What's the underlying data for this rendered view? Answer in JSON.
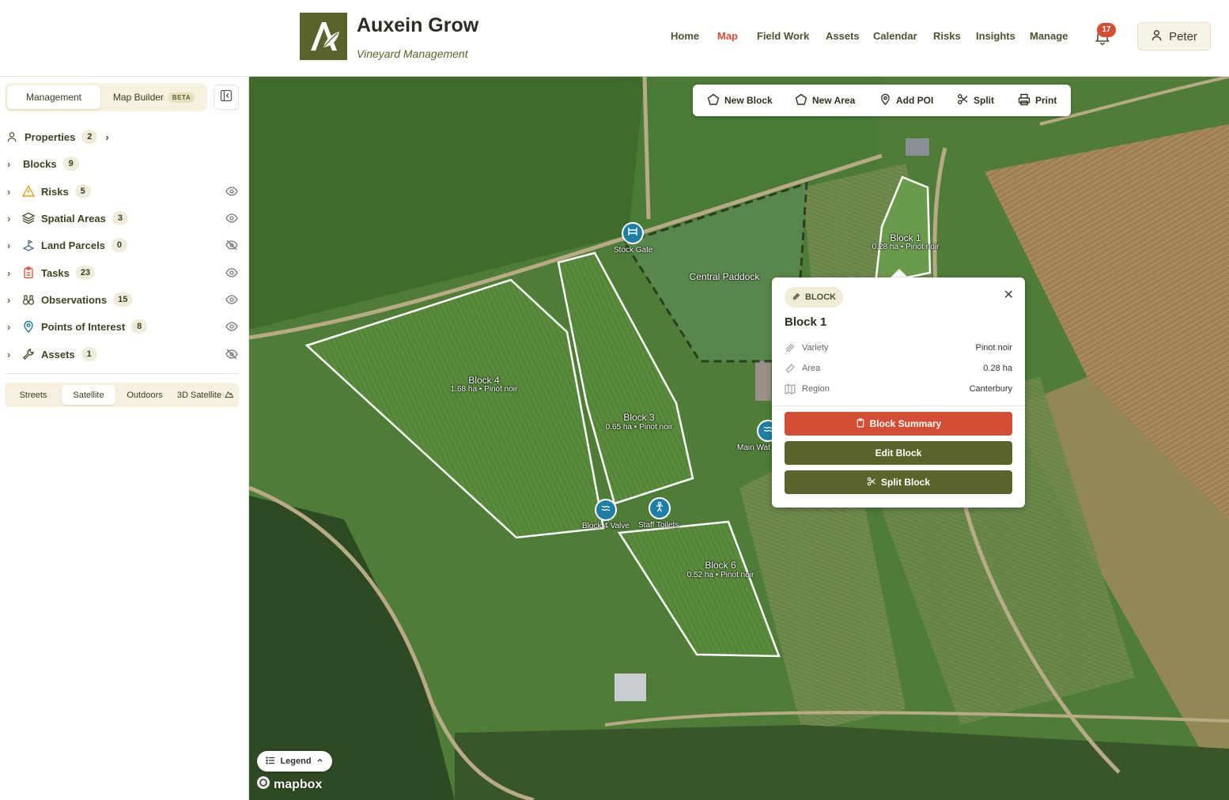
{
  "app": {
    "title": "Auxein Grow",
    "subtitle": "Vineyard Management",
    "logo_icon": "leaf-a-logo"
  },
  "nav": [
    {
      "label": "Home",
      "active": false
    },
    {
      "label": "Map",
      "active": true
    },
    {
      "label": "Field Work",
      "active": false
    },
    {
      "label": "Assets",
      "active": false
    },
    {
      "label": "Calendar",
      "active": false
    },
    {
      "label": "Risks",
      "active": false
    },
    {
      "label": "Insights",
      "active": false
    },
    {
      "label": "Manage",
      "active": false
    }
  ],
  "notifications": {
    "count": "17",
    "icon": "bell-icon"
  },
  "user": {
    "name": "Peter",
    "icon": "user-icon"
  },
  "sidebar": {
    "tabs": [
      {
        "label": "Management",
        "active": true
      },
      {
        "label": "Map Builder",
        "badge": "BETA",
        "active": false
      }
    ],
    "layers": [
      {
        "label": "Properties",
        "count": "2",
        "icon": "properties-icon"
      },
      {
        "label": "Blocks",
        "count": "9"
      },
      {
        "label": "Risks",
        "count": "5",
        "icon": "warning-icon",
        "visible": true
      },
      {
        "label": "Spatial Areas",
        "count": "3",
        "icon": "layers-icon",
        "visible": true
      },
      {
        "label": "Land Parcels",
        "count": "0",
        "icon": "parcel-icon",
        "visible": false
      },
      {
        "label": "Tasks",
        "count": "23",
        "icon": "clipboard-icon",
        "visible": true
      },
      {
        "label": "Observations",
        "count": "15",
        "icon": "binoculars-icon",
        "visible": true
      },
      {
        "label": "Points of Interest",
        "count": "8",
        "icon": "map-pin-icon",
        "visible": true
      },
      {
        "label": "Assets",
        "count": "1",
        "icon": "wrench-icon",
        "visible": false
      }
    ],
    "map_styles": [
      {
        "label": "Streets",
        "active": false
      },
      {
        "label": "Satellite",
        "active": true
      },
      {
        "label": "Outdoors",
        "active": false
      },
      {
        "label": "3D Satellite",
        "active": false
      }
    ]
  },
  "toolbar": [
    {
      "label": "New Block",
      "icon": "pentagon-icon"
    },
    {
      "label": "New Area",
      "icon": "pentagon-icon"
    },
    {
      "label": "Add POI",
      "icon": "map-pin-icon"
    },
    {
      "label": "Split",
      "icon": "scissors-icon"
    },
    {
      "label": "Print",
      "icon": "printer-icon"
    }
  ],
  "map": {
    "blocks": [
      {
        "name": "Block 1",
        "info": "0.28 ha • Pinot noir"
      },
      {
        "name": "Block 3",
        "info": "0.65 ha • Pinot noir"
      },
      {
        "name": "Block 4",
        "info": "1.68 ha • Pinot noir"
      },
      {
        "name": "Block 6",
        "info": "0.52 ha • Pinot noir"
      }
    ],
    "areas": [
      {
        "name": "Central Paddock"
      }
    ],
    "pois": [
      {
        "name": "Stock Gate",
        "icon": "gate-icon"
      },
      {
        "name": "Main Wat",
        "icon": "water-icon"
      },
      {
        "name": "Block 4 Valve",
        "icon": "water-icon"
      },
      {
        "name": "Staff Toilets",
        "icon": "person-icon"
      }
    ]
  },
  "popup": {
    "tag": "BLOCK",
    "title": "Block 1",
    "rows": [
      {
        "label": "Variety",
        "value": "Pinot noir",
        "icon": "grapes-icon"
      },
      {
        "label": "Area",
        "value": "0.28 ha",
        "icon": "ruler-icon"
      },
      {
        "label": "Region",
        "value": "Canterbury",
        "icon": "map-icon"
      }
    ],
    "buttons": {
      "summary": "Block Summary",
      "edit": "Edit Block",
      "split": "Split Block"
    }
  },
  "legend": {
    "label": "Legend"
  },
  "attribution": "mapbox",
  "colors": {
    "brand_olive": "#5a6329",
    "accent_red": "#d34e33",
    "poi_blue": "#1f7ea3"
  }
}
